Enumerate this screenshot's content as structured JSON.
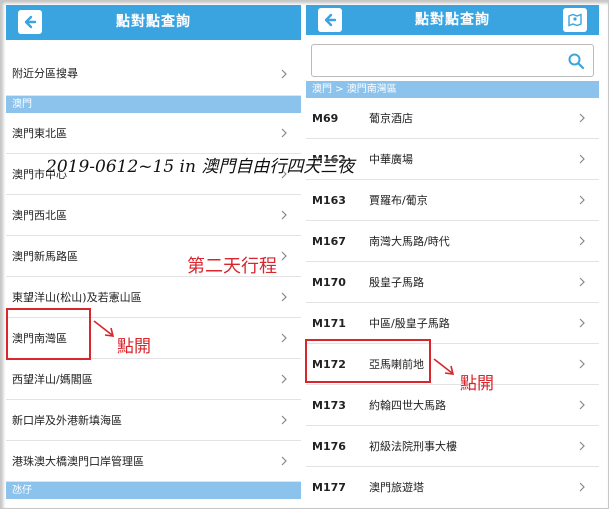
{
  "left_screen": {
    "title": "點對點查詢",
    "rows_top": [
      {
        "label": "附近分區搜尋"
      }
    ],
    "section_macau": "澳門",
    "rows": [
      {
        "label": "澳門東北區"
      },
      {
        "label": "澳門市中心"
      },
      {
        "label": "澳門西北區"
      },
      {
        "label": "澳門新馬路區"
      },
      {
        "label": "東望洋山(松山)及若憲山區"
      },
      {
        "label": "澳門南灣區"
      },
      {
        "label": "西望洋山/媽閣區"
      },
      {
        "label": "新口岸及外港新填海區"
      },
      {
        "label": "港珠澳大橋澳門口岸管理區"
      }
    ],
    "section_taipa": "氹仔"
  },
  "right_screen": {
    "title": "點對點查詢",
    "search_placeholder": "",
    "breadcrumb": "澳門 > 澳門南灣區",
    "rows": [
      {
        "code": "M69",
        "name": "葡京酒店"
      },
      {
        "code": "M162",
        "name": "中華廣場"
      },
      {
        "code": "M163",
        "name": "賈羅布/葡京"
      },
      {
        "code": "M167",
        "name": "南灣大馬路/時代"
      },
      {
        "code": "M170",
        "name": "殷皇子馬路"
      },
      {
        "code": "M171",
        "name": "中區/殷皇子馬路"
      },
      {
        "code": "M172",
        "name": "亞馬喇前地"
      },
      {
        "code": "M173",
        "name": "約翰四世大馬路"
      },
      {
        "code": "M176",
        "name": "初級法院刑事大樓"
      },
      {
        "code": "M177",
        "name": "澳門旅遊塔"
      }
    ]
  },
  "annotations": {
    "overlay_title": "2019-0612~15 in 澳門自由行四天三夜",
    "day_label": "第二天行程",
    "tap_left": "點開",
    "tap_right": "點開"
  },
  "colors": {
    "header": "#3aa4e0",
    "section": "#8cc3ec",
    "highlight": "#d8262c"
  }
}
